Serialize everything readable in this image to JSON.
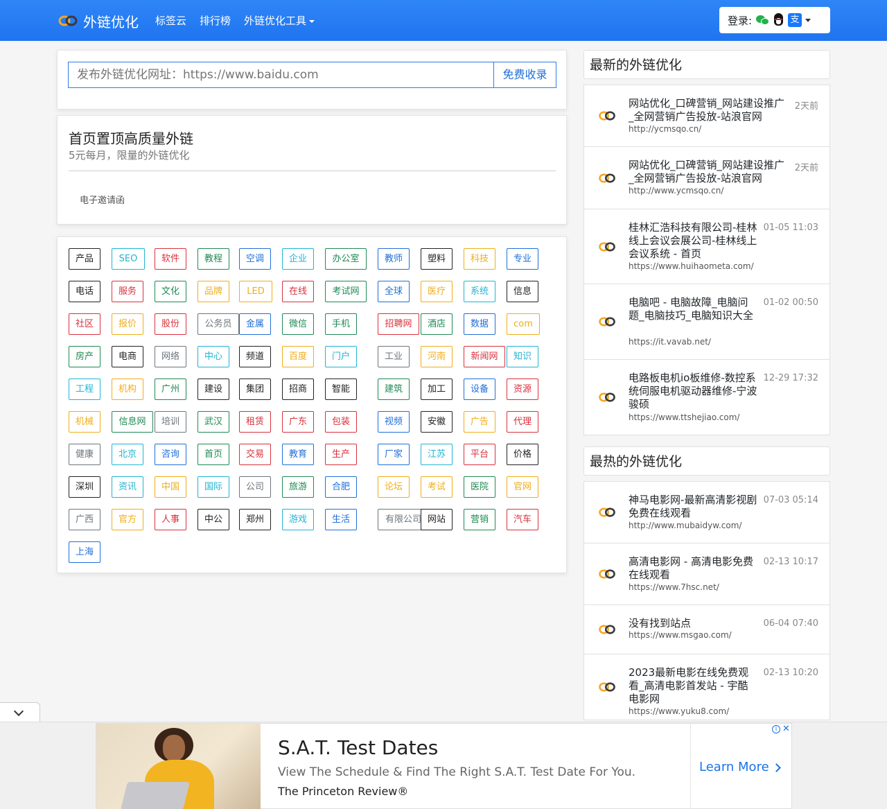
{
  "navbar": {
    "brand": "外链优化",
    "links": [
      "标签云",
      "排行榜",
      "外链优化工具"
    ],
    "login_label": "登录:",
    "alipay_glyph": "支"
  },
  "submit": {
    "placeholder": "发布外链优化网址：https://www.baidu.com",
    "button": "免费收录"
  },
  "top": {
    "title": "首页置顶高质量外链",
    "subtitle": "5元每月，限量的外链优化",
    "link": "电子邀请函"
  },
  "tag_colors": {
    "dark": "#222222",
    "cyan": "#1fb5d3",
    "red": "#d9303c",
    "green": "#1e8a53",
    "blue": "#1f6fd8",
    "yellow": "#f0ad19",
    "gray": "#6c757d"
  },
  "tags": [
    {
      "t": "产品",
      "c": "dark"
    },
    {
      "t": "SEO",
      "c": "cyan"
    },
    {
      "t": "软件",
      "c": "red"
    },
    {
      "t": "教程",
      "c": "green"
    },
    {
      "t": "空调",
      "c": "blue"
    },
    {
      "t": "企业",
      "c": "cyan"
    },
    {
      "t": "办公室",
      "c": "green"
    },
    {
      "t": "教师",
      "c": "blue"
    },
    {
      "t": "塑料",
      "c": "dark"
    },
    {
      "t": "科技",
      "c": "yellow"
    },
    {
      "t": "专业",
      "c": "blue"
    },
    {
      "t": "电话",
      "c": "dark"
    },
    {
      "t": "服务",
      "c": "red"
    },
    {
      "t": "文化",
      "c": "green"
    },
    {
      "t": "品牌",
      "c": "yellow"
    },
    {
      "t": "LED",
      "c": "yellow"
    },
    {
      "t": "在线",
      "c": "red"
    },
    {
      "t": "考试网",
      "c": "green"
    },
    {
      "t": "全球",
      "c": "blue"
    },
    {
      "t": "医疗",
      "c": "yellow"
    },
    {
      "t": "系统",
      "c": "cyan"
    },
    {
      "t": "信息",
      "c": "dark"
    },
    {
      "t": "社区",
      "c": "red"
    },
    {
      "t": "报价",
      "c": "yellow"
    },
    {
      "t": "股份",
      "c": "red"
    },
    {
      "t": "公务员",
      "c": "gray"
    },
    {
      "t": "金属",
      "c": "blue"
    },
    {
      "t": "微信",
      "c": "green"
    },
    {
      "t": "手机",
      "c": "green"
    },
    {
      "t": "招聘网",
      "c": "red"
    },
    {
      "t": "酒店",
      "c": "green"
    },
    {
      "t": "数据",
      "c": "blue"
    },
    {
      "t": "com",
      "c": "yellow"
    },
    {
      "t": "房产",
      "c": "green"
    },
    {
      "t": "电商",
      "c": "dark"
    },
    {
      "t": "网络",
      "c": "gray"
    },
    {
      "t": "中心",
      "c": "cyan"
    },
    {
      "t": "频道",
      "c": "dark"
    },
    {
      "t": "百度",
      "c": "yellow"
    },
    {
      "t": "门户",
      "c": "cyan"
    },
    {
      "t": "工业",
      "c": "gray"
    },
    {
      "t": "河南",
      "c": "yellow"
    },
    {
      "t": "新闻网",
      "c": "red"
    },
    {
      "t": "知识",
      "c": "cyan"
    },
    {
      "t": "工程",
      "c": "cyan"
    },
    {
      "t": "机构",
      "c": "yellow"
    },
    {
      "t": "广州",
      "c": "green"
    },
    {
      "t": "建设",
      "c": "dark"
    },
    {
      "t": "集团",
      "c": "dark"
    },
    {
      "t": "招商",
      "c": "dark"
    },
    {
      "t": "智能",
      "c": "dark"
    },
    {
      "t": "建筑",
      "c": "green"
    },
    {
      "t": "加工",
      "c": "dark"
    },
    {
      "t": "设备",
      "c": "blue"
    },
    {
      "t": "资源",
      "c": "red"
    },
    {
      "t": "机械",
      "c": "yellow"
    },
    {
      "t": "信息网",
      "c": "green"
    },
    {
      "t": "培训",
      "c": "gray"
    },
    {
      "t": "武汉",
      "c": "green"
    },
    {
      "t": "租赁",
      "c": "red"
    },
    {
      "t": "广东",
      "c": "red"
    },
    {
      "t": "包装",
      "c": "red"
    },
    {
      "t": "视频",
      "c": "blue"
    },
    {
      "t": "安徽",
      "c": "dark"
    },
    {
      "t": "广告",
      "c": "yellow"
    },
    {
      "t": "代理",
      "c": "red"
    },
    {
      "t": "健康",
      "c": "gray"
    },
    {
      "t": "北京",
      "c": "cyan"
    },
    {
      "t": "咨询",
      "c": "blue"
    },
    {
      "t": "首页",
      "c": "green"
    },
    {
      "t": "交易",
      "c": "red"
    },
    {
      "t": "教育",
      "c": "blue"
    },
    {
      "t": "生产",
      "c": "red"
    },
    {
      "t": "厂家",
      "c": "blue"
    },
    {
      "t": "江苏",
      "c": "cyan"
    },
    {
      "t": "平台",
      "c": "red"
    },
    {
      "t": "价格",
      "c": "dark"
    },
    {
      "t": "深圳",
      "c": "dark"
    },
    {
      "t": "资讯",
      "c": "cyan"
    },
    {
      "t": "中国",
      "c": "yellow"
    },
    {
      "t": "国际",
      "c": "cyan"
    },
    {
      "t": "公司",
      "c": "gray"
    },
    {
      "t": "旅游",
      "c": "green"
    },
    {
      "t": "合肥",
      "c": "blue"
    },
    {
      "t": "论坛",
      "c": "yellow"
    },
    {
      "t": "考试",
      "c": "yellow"
    },
    {
      "t": "医院",
      "c": "green"
    },
    {
      "t": "官网",
      "c": "yellow"
    },
    {
      "t": "广西",
      "c": "gray"
    },
    {
      "t": "官方",
      "c": "yellow"
    },
    {
      "t": "人事",
      "c": "red"
    },
    {
      "t": "中公",
      "c": "dark"
    },
    {
      "t": "郑州",
      "c": "dark"
    },
    {
      "t": "游戏",
      "c": "cyan"
    },
    {
      "t": "生活",
      "c": "blue"
    },
    {
      "t": "有限公司",
      "c": "gray"
    },
    {
      "t": "网站",
      "c": "dark"
    },
    {
      "t": "营销",
      "c": "green"
    },
    {
      "t": "汽车",
      "c": "red"
    },
    {
      "t": "上海",
      "c": "blue"
    }
  ],
  "latest": {
    "heading": "最新的外链优化",
    "items": [
      {
        "title": "网站优化_口碑营销_网站建设推广_全网营销广告投放-站浪官网",
        "url": "http://ycmsqo.cn/",
        "time": "2天前"
      },
      {
        "title": "网站优化_口碑营销_网站建设推广_全网营销广告投放-站浪官网",
        "url": "http://www.ycmsqo.cn/",
        "time": "2天前"
      },
      {
        "title": "桂林汇浩科技有限公司-桂林线上会议会展公司-桂林线上会议系统 - 首页",
        "url": "https://www.huihaometa.com/",
        "time": "01-05 11:03"
      },
      {
        "title": "电脑吧 - 电脑故障_电脑问题_电脑技巧_电脑知识大全",
        "url": "https://it.vavab.net/",
        "time": "01-02 00:50"
      },
      {
        "title": "电路板电机io板维修-数控系统伺服电机驱动器维修-宁波骏硕",
        "url": "https://www.ttshejiao.com/",
        "time": "12-29 17:32"
      }
    ]
  },
  "hottest": {
    "heading": "最热的外链优化",
    "items": [
      {
        "title": "神马电影网-最新高清影视剧免费在线观看",
        "url": "http://www.mubaidyw.com/",
        "time": "07-03 05:14"
      },
      {
        "title": "高清电影网 - 高清电影免费在线观看",
        "url": "https://www.7hsc.net/",
        "time": "02-13 10:17"
      },
      {
        "title": "没有找到站点",
        "url": "https://www.msgao.com/",
        "time": "06-04 07:40"
      },
      {
        "title": "2023最新电影在线免费观看_高清电影首发站 - 宇酷电影网",
        "url": "https://www.yuku8.com/",
        "time": "02-13 10:20"
      }
    ]
  },
  "ad": {
    "title": "S.A.T. Test Dates",
    "description": "View The Schedule & Find The Right S.A.T. Test Date For You.",
    "brand": "The Princeton Review®",
    "cta": "Learn More",
    "info_glyph": "i",
    "close_glyph": "✕"
  }
}
